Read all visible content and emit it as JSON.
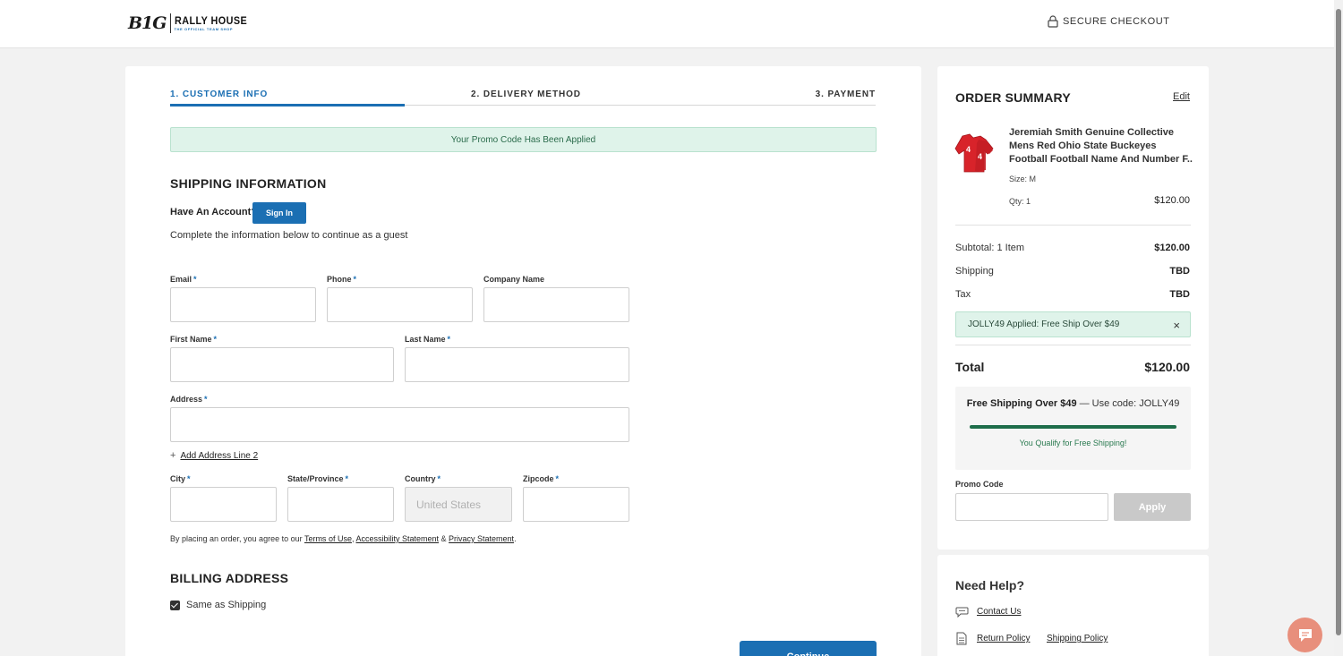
{
  "header": {
    "logo_b1g": "B1G",
    "logo_brand": "RALLY HOUSE",
    "logo_subtitle": "THE OFFICIAL TEAM SHOP",
    "secure_label": "SECURE CHECKOUT"
  },
  "steps": [
    {
      "label": "1. CUSTOMER INFO",
      "active": true
    },
    {
      "label": "2. DELIVERY METHOD",
      "active": false
    },
    {
      "label": "3. PAYMENT",
      "active": false
    }
  ],
  "promo_banner": "Your Promo Code Has Been Applied",
  "shipping": {
    "title": "SHIPPING INFORMATION",
    "have_account": "Have An Account?",
    "sign_in": "Sign In",
    "guest_text": "Complete the information below to continue as a guest",
    "fields": {
      "email": {
        "label": "Email",
        "required": "*",
        "value": ""
      },
      "phone": {
        "label": "Phone",
        "required": "*",
        "value": ""
      },
      "company": {
        "label": "Company Name",
        "value": ""
      },
      "first_name": {
        "label": "First Name",
        "required": "*",
        "value": ""
      },
      "last_name": {
        "label": "Last Name",
        "required": "*",
        "value": ""
      },
      "address": {
        "label": "Address",
        "required": "*",
        "value": ""
      },
      "city": {
        "label": "City",
        "required": "*",
        "value": ""
      },
      "state": {
        "label": "State/Province",
        "required": "*",
        "value": ""
      },
      "country": {
        "label": "Country",
        "required": "*",
        "value": "United States"
      },
      "zipcode": {
        "label": "Zipcode",
        "required": "*",
        "value": ""
      }
    },
    "add_address_line": "Add Address Line 2",
    "plus": "+",
    "terms_prefix": "By placing an order, you agree to our ",
    "terms_link": "Terms of Use",
    "terms_comma": ", ",
    "accessibility_link": "Accessibility Statement",
    "terms_amp": " & ",
    "privacy_link": "Privacy Statement",
    "terms_end": "."
  },
  "billing": {
    "title": "BILLING ADDRESS",
    "same_as_shipping": "Same as Shipping",
    "same_checked": true
  },
  "continue_label": "Continue",
  "summary": {
    "title": "ORDER SUMMARY",
    "edit": "Edit",
    "product": {
      "name": "Jeremiah Smith Genuine Collective Mens Red Ohio State Buckeyes Football Football Name And Number F..",
      "size": "Size:  M",
      "qty": "Qty: 1",
      "price": "$120.00",
      "jersey_number": "4"
    },
    "subtotal_label": "Subtotal: 1 Item",
    "subtotal_value": "$120.00",
    "shipping_label": "Shipping",
    "shipping_value": "TBD",
    "tax_label": "Tax",
    "tax_value": "TBD",
    "coupon_text": "JOLLY49 Applied: Free Ship Over $49",
    "coupon_remove": "×",
    "total_label": "Total",
    "total_value": "$120.00",
    "free_ship_bold": "Free Shipping Over $49",
    "free_ship_rest": " — Use code: JOLLY49",
    "free_ship_progress": 1.0,
    "qualify_text": "You Qualify for Free Shipping!",
    "promo_label": "Promo Code",
    "promo_value": "",
    "apply": "Apply"
  },
  "help": {
    "title": "Need Help?",
    "contact": "Contact Us",
    "return_policy": "Return Policy",
    "shipping_policy": "Shipping Policy"
  },
  "colors": {
    "accent": "#1b6fb3",
    "success_bg": "#dff3ea",
    "progress": "#1e6e4a",
    "chat": "#e88f7c"
  }
}
